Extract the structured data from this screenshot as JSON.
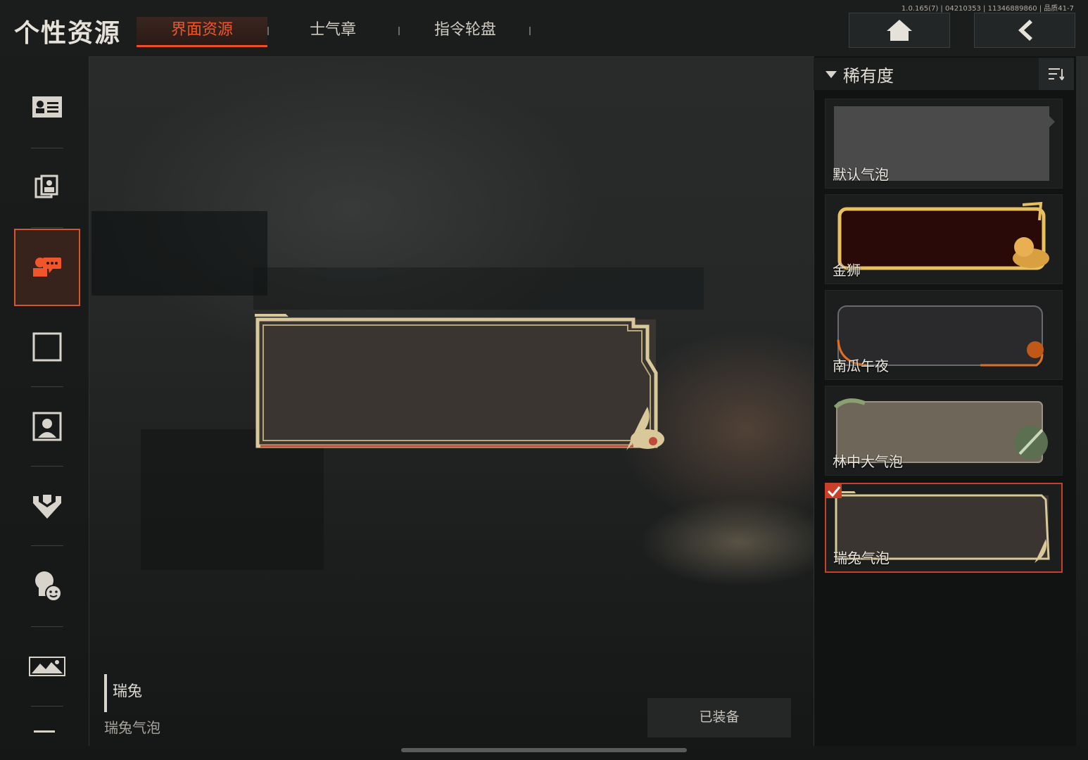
{
  "header": {
    "title": "个性资源",
    "tabs": [
      {
        "label": "界面资源",
        "active": true
      },
      {
        "label": "士气章",
        "active": false
      },
      {
        "label": "指令轮盘",
        "active": false
      }
    ],
    "version": "1.0.165(7) | 04210353 | 11346889860 | 品质41-7",
    "home_icon": "home-icon",
    "back_icon": "back-arrow-icon"
  },
  "sidebar": {
    "items": [
      {
        "icon": "id-card-icon",
        "active": false
      },
      {
        "icon": "photo-cards-icon",
        "active": false
      },
      {
        "icon": "chat-bubble-icon",
        "active": true
      },
      {
        "icon": "frame-icon",
        "active": false
      },
      {
        "icon": "portrait-icon",
        "active": false
      },
      {
        "icon": "badge-icon",
        "active": false
      },
      {
        "icon": "emote-icon",
        "active": false
      },
      {
        "icon": "landscape-icon",
        "active": false
      }
    ]
  },
  "preview": {
    "name": "瑞兔",
    "type": "瑞兔气泡",
    "equip_button": "已装备"
  },
  "filter": {
    "label": "稀有度",
    "sort_icon": "sort-icon"
  },
  "bubbles": [
    {
      "label": "默认气泡",
      "selected": false
    },
    {
      "label": "金狮",
      "selected": false
    },
    {
      "label": "南瓜午夜",
      "selected": false
    },
    {
      "label": "林中大气泡",
      "selected": false
    },
    {
      "label": "瑞兔气泡",
      "selected": true
    }
  ],
  "colors": {
    "accent": "#e8502a",
    "gold": "#d8b868",
    "panel": "#111313"
  }
}
